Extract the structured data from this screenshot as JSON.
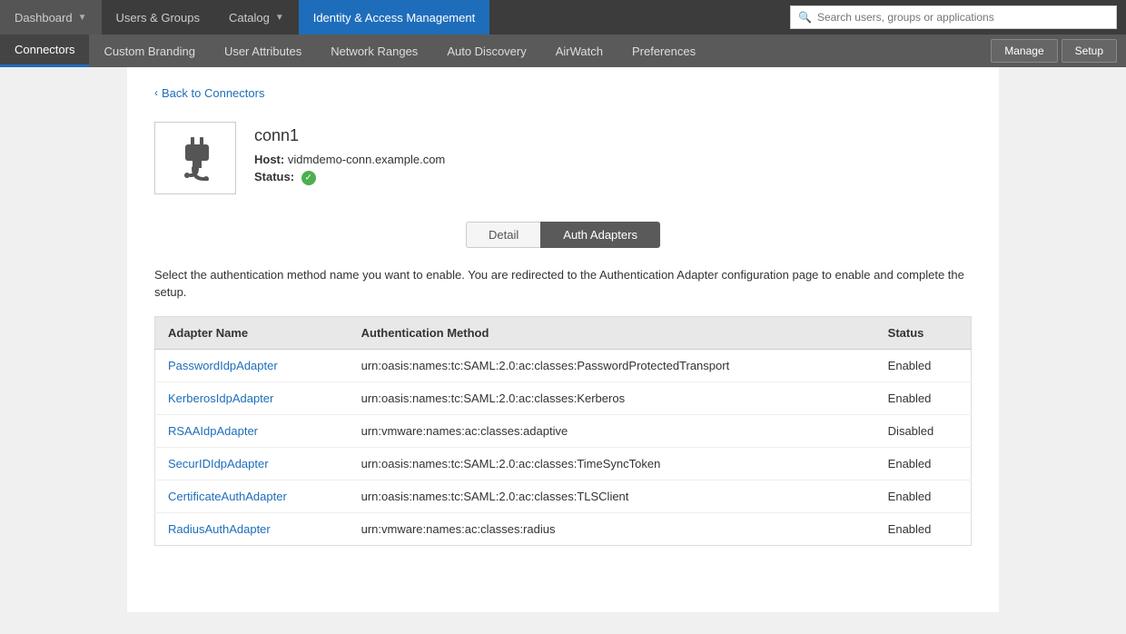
{
  "topNav": {
    "buttons": [
      {
        "id": "dashboard",
        "label": "Dashboard",
        "hasDropdown": true,
        "active": false
      },
      {
        "id": "users-groups",
        "label": "Users & Groups",
        "hasDropdown": false,
        "active": false
      },
      {
        "id": "catalog",
        "label": "Catalog",
        "hasDropdown": true,
        "active": false
      },
      {
        "id": "identity-access",
        "label": "Identity & Access Management",
        "hasDropdown": false,
        "active": true
      }
    ],
    "search": {
      "placeholder": "Search users, groups or applications"
    }
  },
  "subNav": {
    "items": [
      {
        "id": "connectors",
        "label": "Connectors",
        "active": true
      },
      {
        "id": "custom-branding",
        "label": "Custom Branding",
        "active": false
      },
      {
        "id": "user-attributes",
        "label": "User Attributes",
        "active": false
      },
      {
        "id": "network-ranges",
        "label": "Network Ranges",
        "active": false
      },
      {
        "id": "auto-discovery",
        "label": "Auto Discovery",
        "active": false
      },
      {
        "id": "airwatch",
        "label": "AirWatch",
        "active": false
      },
      {
        "id": "preferences",
        "label": "Preferences",
        "active": false
      }
    ],
    "buttons": [
      {
        "id": "manage",
        "label": "Manage"
      },
      {
        "id": "setup",
        "label": "Setup"
      }
    ]
  },
  "page": {
    "backLink": "Back to Connectors",
    "connector": {
      "name": "conn1",
      "host_label": "Host:",
      "host_value": "vidmdemo-conn.example.com",
      "status_label": "Status:",
      "status_value": "active"
    },
    "tabs": [
      {
        "id": "detail",
        "label": "Detail",
        "active": false
      },
      {
        "id": "auth-adapters",
        "label": "Auth Adapters",
        "active": true
      }
    ],
    "description": "Select the authentication method name you want to enable. You are redirected to the Authentication Adapter configuration page to enable and complete the setup.",
    "table": {
      "headers": [
        "Adapter Name",
        "Authentication Method",
        "Status"
      ],
      "rows": [
        {
          "adapter_name": "PasswordIdpAdapter",
          "auth_method": "urn:oasis:names:tc:SAML:2.0:ac:classes:PasswordProtectedTransport",
          "status": "Enabled"
        },
        {
          "adapter_name": "KerberosIdpAdapter",
          "auth_method": "urn:oasis:names:tc:SAML:2.0:ac:classes:Kerberos",
          "status": "Enabled"
        },
        {
          "adapter_name": "RSAAIdpAdapter",
          "auth_method": "urn:vmware:names:ac:classes:adaptive",
          "status": "Disabled"
        },
        {
          "adapter_name": "SecurIDIdpAdapter",
          "auth_method": "urn:oasis:names:tc:SAML:2.0:ac:classes:TimeSyncToken",
          "status": "Enabled"
        },
        {
          "adapter_name": "CertificateAuthAdapter",
          "auth_method": "urn:oasis:names:tc:SAML:2.0:ac:classes:TLSClient",
          "status": "Enabled"
        },
        {
          "adapter_name": "RadiusAuthAdapter",
          "auth_method": "urn:vmware:names:ac:classes:radius",
          "status": "Enabled"
        }
      ]
    }
  }
}
